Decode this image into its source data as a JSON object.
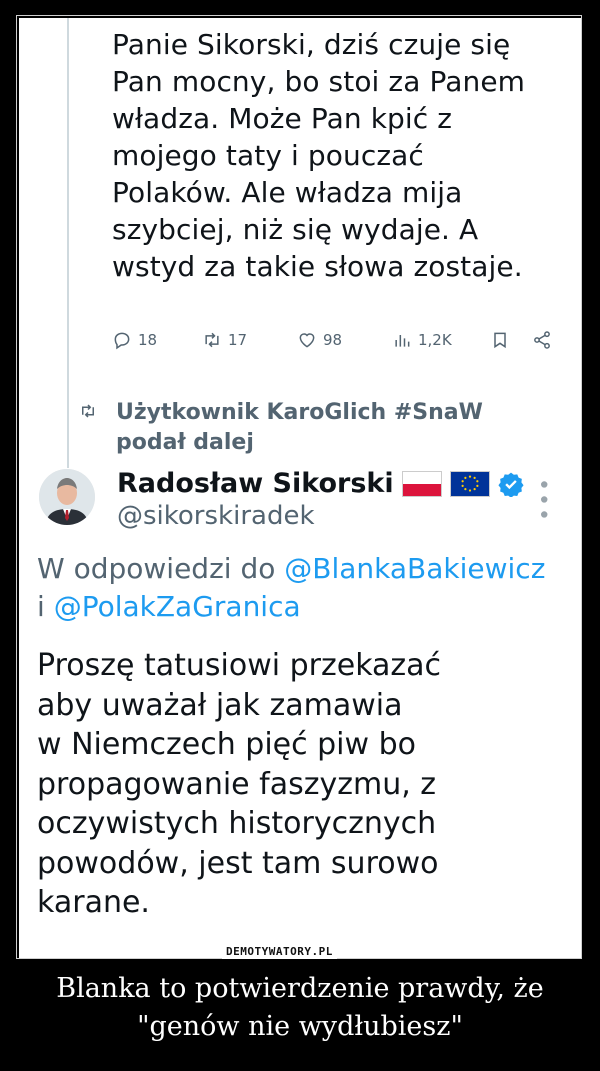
{
  "tweet1": {
    "lines": [
      "Panie Sikorski, dziś czuje się",
      "Pan mocny, bo stoi za Panem",
      "władza. Może Pan kpić z",
      "mojego taty i pouczać",
      "Polaków. Ale władza mija",
      "szybciej, niż się wydaje. A",
      "wstyd za takie słowa zostaje."
    ],
    "stats": {
      "replies": "18",
      "retweets": "17",
      "likes": "98",
      "views": "1,2K"
    }
  },
  "retweet_header": {
    "line1": "Użytkownik KaroGlich #SnaW",
    "line2": "podał dalej"
  },
  "tweet2": {
    "author_name": "Radosław Sikorski",
    "handle": "@sikorskiradek",
    "reply_prefix": "W odpowiedzi do ",
    "mention1": "@BlankaBakiewicz",
    "reply_and": "i ",
    "mention2": "@PolakZaGranica",
    "lines": [
      "Proszę tatusiowi przekazać",
      "aby uważał jak zamawia",
      "w Niemczech pięć piw bo",
      "propagowanie faszyzmu, z",
      "oczywistych historycznych",
      "powodów, jest tam surowo",
      "karane."
    ]
  },
  "watermark": "DEMOTYWATORY.PL",
  "caption": {
    "line1": "Blanka to potwierdzenie prawdy, że",
    "line2": "\"genów nie wydłubiesz\""
  },
  "colors": {
    "text": "#0f1419",
    "secondary": "#536471",
    "link": "#1d9bf0",
    "background": "#000000"
  }
}
